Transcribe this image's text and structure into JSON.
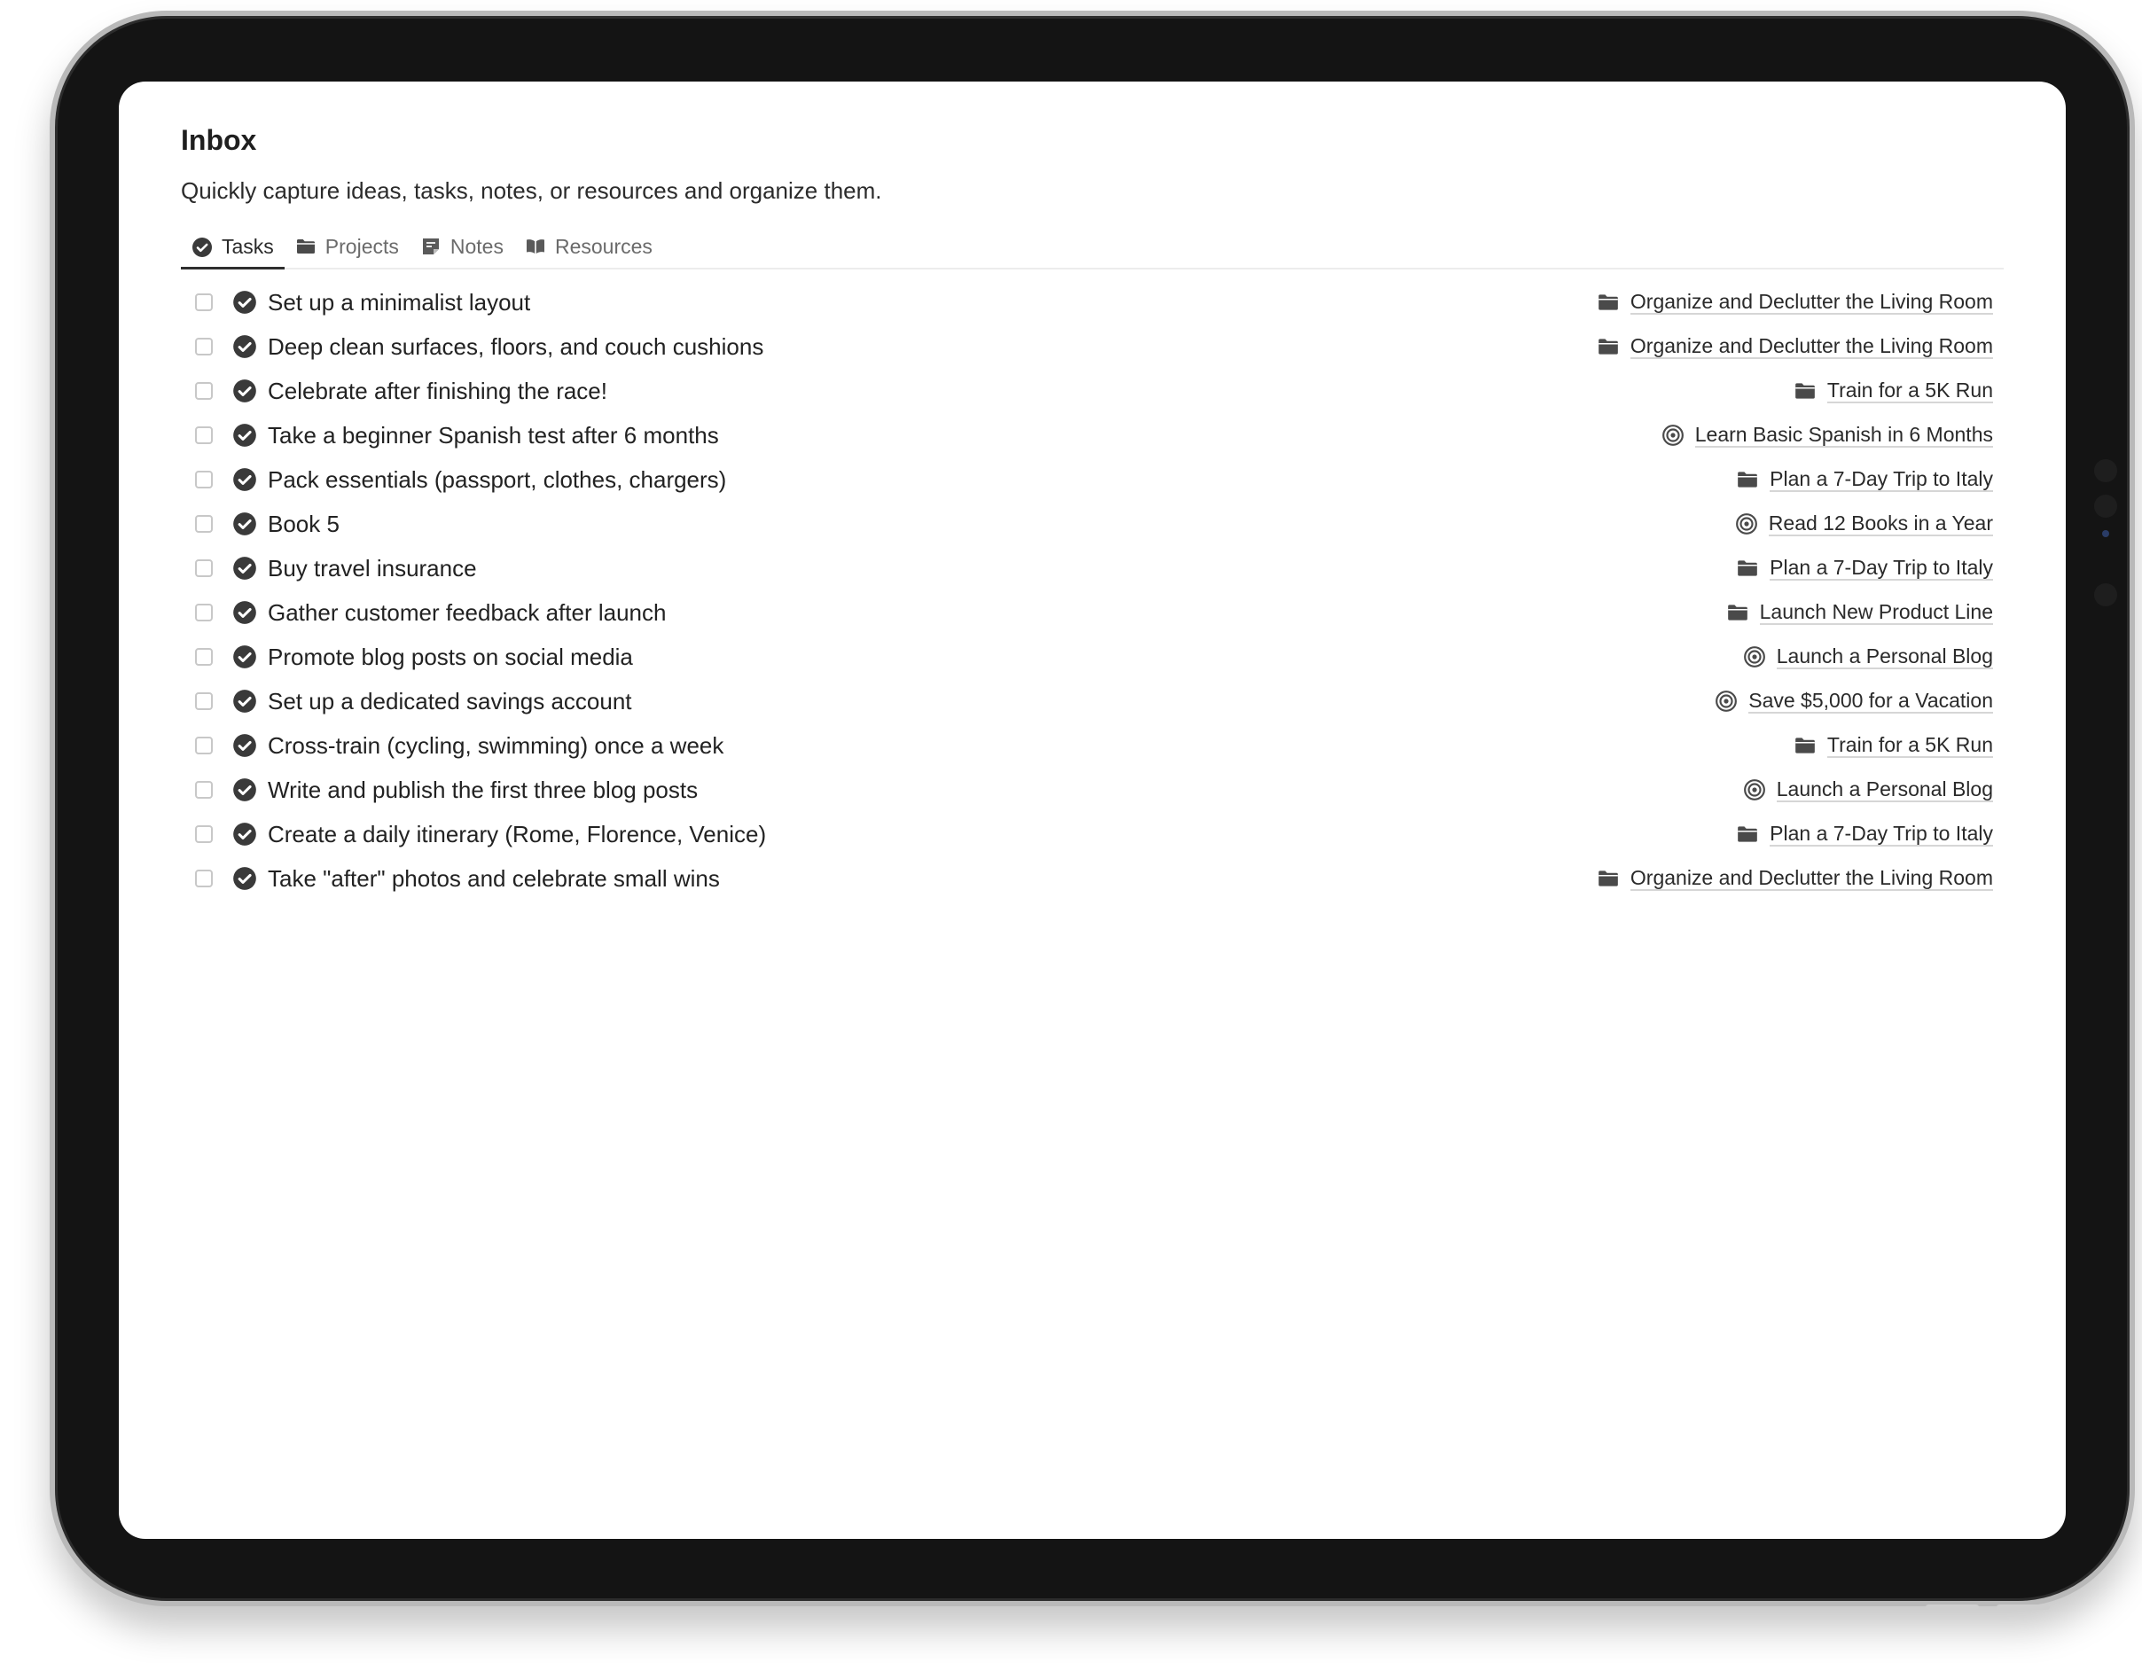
{
  "page": {
    "title": "Inbox",
    "description": "Quickly capture ideas, tasks, notes, or resources and organize them."
  },
  "tabs": [
    {
      "label": "Tasks",
      "icon": "check-circle-icon",
      "active": true
    },
    {
      "label": "Projects",
      "icon": "folder-icon",
      "active": false
    },
    {
      "label": "Notes",
      "icon": "note-icon",
      "active": false
    },
    {
      "label": "Resources",
      "icon": "book-icon",
      "active": false
    }
  ],
  "tasks": [
    {
      "title": "Set up a minimalist layout",
      "project": "Organize and Declutter the Living Room",
      "project_icon": "folder-icon"
    },
    {
      "title": "Deep clean surfaces, floors, and couch cushions",
      "project": "Organize and Declutter the Living Room",
      "project_icon": "folder-icon"
    },
    {
      "title": "Celebrate after finishing the race!",
      "project": "Train for a 5K Run",
      "project_icon": "folder-icon"
    },
    {
      "title": "Take a beginner Spanish test after 6 months",
      "project": "Learn Basic Spanish in 6 Months",
      "project_icon": "target-icon"
    },
    {
      "title": "Pack essentials (passport, clothes, chargers)",
      "project": "Plan a 7-Day Trip to Italy",
      "project_icon": "folder-icon"
    },
    {
      "title": "Book 5",
      "project": "Read 12 Books in a Year",
      "project_icon": "target-icon"
    },
    {
      "title": "Buy travel insurance",
      "project": "Plan a 7-Day Trip to Italy",
      "project_icon": "folder-icon"
    },
    {
      "title": "Gather customer feedback after launch",
      "project": "Launch New Product Line",
      "project_icon": "folder-icon"
    },
    {
      "title": "Promote blog posts on social media",
      "project": "Launch a Personal Blog",
      "project_icon": "target-icon"
    },
    {
      "title": "Set up a dedicated savings account",
      "project": "Save $5,000 for a Vacation",
      "project_icon": "target-icon"
    },
    {
      "title": "Cross-train (cycling, swimming) once a week",
      "project": "Train for a 5K Run",
      "project_icon": "folder-icon"
    },
    {
      "title": "Write and publish the first three blog posts",
      "project": "Launch a Personal Blog",
      "project_icon": "target-icon"
    },
    {
      "title": "Create a daily itinerary (Rome, Florence, Venice)",
      "project": "Plan a 7-Day Trip to Italy",
      "project_icon": "folder-icon"
    },
    {
      "title": "Take \"after\" photos and celebrate small wins",
      "project": "Organize and Declutter the Living Room",
      "project_icon": "folder-icon"
    }
  ],
  "colors": {
    "text": "#222222",
    "muted": "#6b6b6b",
    "icon": "#3a3a3a",
    "device_frame": "#141414",
    "screen": "#ffffff"
  }
}
